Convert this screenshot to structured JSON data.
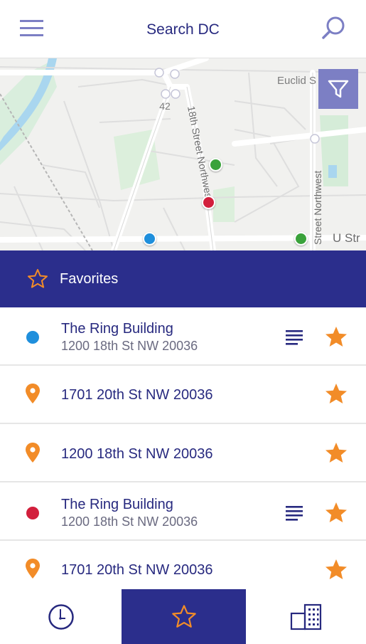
{
  "header": {
    "title": "Search DC",
    "menu_icon": "hamburger-menu-icon",
    "search_icon": "search-icon"
  },
  "map": {
    "labels": {
      "street_18th": "18th Street Northwest",
      "street_north": "Street Northwest",
      "euclid": "Euclid S",
      "route": "42",
      "u_street": "U Str"
    },
    "filter_icon": "filter-icon",
    "pins": [
      {
        "color": "#3aa23b"
      },
      {
        "color": "#d21f3c"
      },
      {
        "color": "#1f8fdc"
      },
      {
        "color": "#3aa23b"
      }
    ]
  },
  "favorites": {
    "label": "Favorites",
    "accent": "#f28c28",
    "bar_color": "#2b2e8c",
    "items": [
      {
        "name": "The Ring Building",
        "address": "1200 18th St NW 20036",
        "marker": "dot",
        "marker_color": "#1f8fdc",
        "has_details": true
      },
      {
        "name": "",
        "address": "1701 20th St NW 20036",
        "marker": "pin",
        "marker_color": "#f28c28",
        "has_details": false
      },
      {
        "name": "",
        "address": "1200 18th St NW 20036",
        "marker": "pin",
        "marker_color": "#f28c28",
        "has_details": false
      },
      {
        "name": "The Ring Building",
        "address": "1200 18th St NW 20036",
        "marker": "dot",
        "marker_color": "#d21f3c",
        "has_details": true
      },
      {
        "name": "",
        "address": "1701 20th St NW 20036",
        "marker": "pin",
        "marker_color": "#f28c28",
        "has_details": false
      }
    ]
  },
  "bottom_nav": {
    "tabs": [
      {
        "icon": "clock-icon",
        "active": false
      },
      {
        "icon": "star-icon",
        "active": true
      },
      {
        "icon": "buildings-icon",
        "active": false
      }
    ]
  }
}
